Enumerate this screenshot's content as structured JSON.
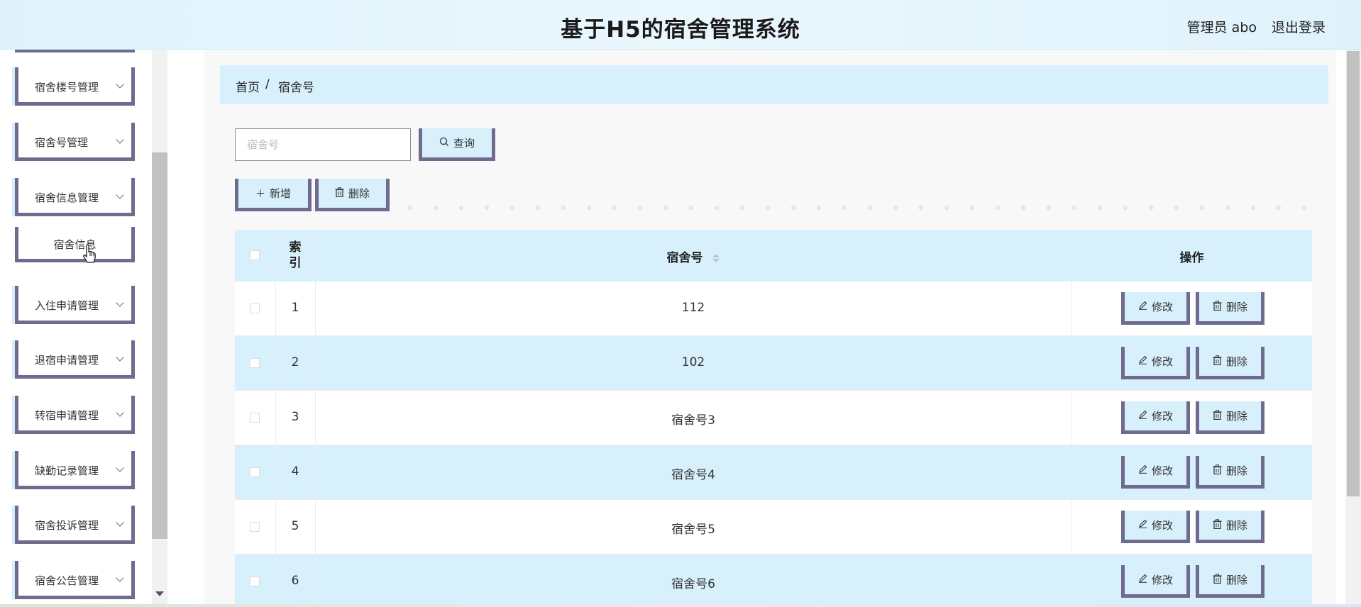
{
  "header": {
    "title": "基于H5的宿舍管理系统",
    "user": "管理员 abo",
    "logout": "退出登录"
  },
  "sidebar": {
    "items": [
      {
        "label": "宿舍楼号管理"
      },
      {
        "label": "宿舍号管理"
      },
      {
        "label": "宿舍信息管理"
      },
      {
        "label": "宿舍信息"
      },
      {
        "label": "入住申请管理"
      },
      {
        "label": "退宿申请管理"
      },
      {
        "label": "转宿申请管理"
      },
      {
        "label": "缺勤记录管理"
      },
      {
        "label": "宿舍投诉管理"
      },
      {
        "label": "宿舍公告管理"
      }
    ]
  },
  "breadcrumb": {
    "home": "首页",
    "separator": "/",
    "current": "宿舍号"
  },
  "search": {
    "placeholder": "宿舍号",
    "button": "查询"
  },
  "toolbar": {
    "add": "新增",
    "delete": "删除"
  },
  "table": {
    "headers": {
      "index_line1": "索",
      "index_line2": "引",
      "room": "宿舍号",
      "ops": "操作"
    },
    "rows": [
      {
        "index": "1",
        "room": "112"
      },
      {
        "index": "2",
        "room": "102"
      },
      {
        "index": "3",
        "room": "宿舍号3"
      },
      {
        "index": "4",
        "room": "宿舍号4"
      },
      {
        "index": "5",
        "room": "宿舍号5"
      },
      {
        "index": "6",
        "room": "宿舍号6"
      }
    ],
    "edit_label": "修改",
    "delete_label": "删除"
  },
  "colors": {
    "accent_light_blue": "#d7f0fb",
    "border_purple": "#6f6b8e"
  }
}
